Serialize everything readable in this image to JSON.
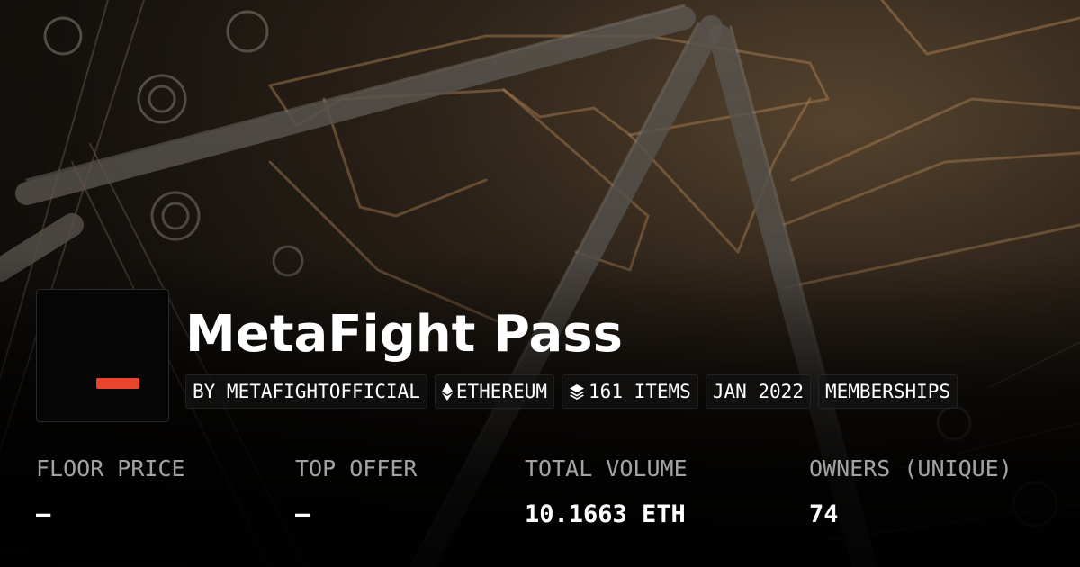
{
  "collection": {
    "name": "MetaFight Pass",
    "accent_color": "#e8452c"
  },
  "tags": {
    "creator": "BY METAFIGHTOFFICIAL",
    "chain": "ETHEREUM",
    "chain_icon": "ethereum-icon",
    "items": "161 ITEMS",
    "items_icon": "layers-icon",
    "created": "JAN 2022",
    "category": "MEMBERSHIPS"
  },
  "stats": [
    {
      "label": "FLOOR PRICE",
      "value": "—"
    },
    {
      "label": "TOP OFFER",
      "value": "—"
    },
    {
      "label": "TOTAL VOLUME",
      "value": "10.1663 ETH"
    },
    {
      "label": "OWNERS (UNIQUE)",
      "value": "74"
    }
  ]
}
